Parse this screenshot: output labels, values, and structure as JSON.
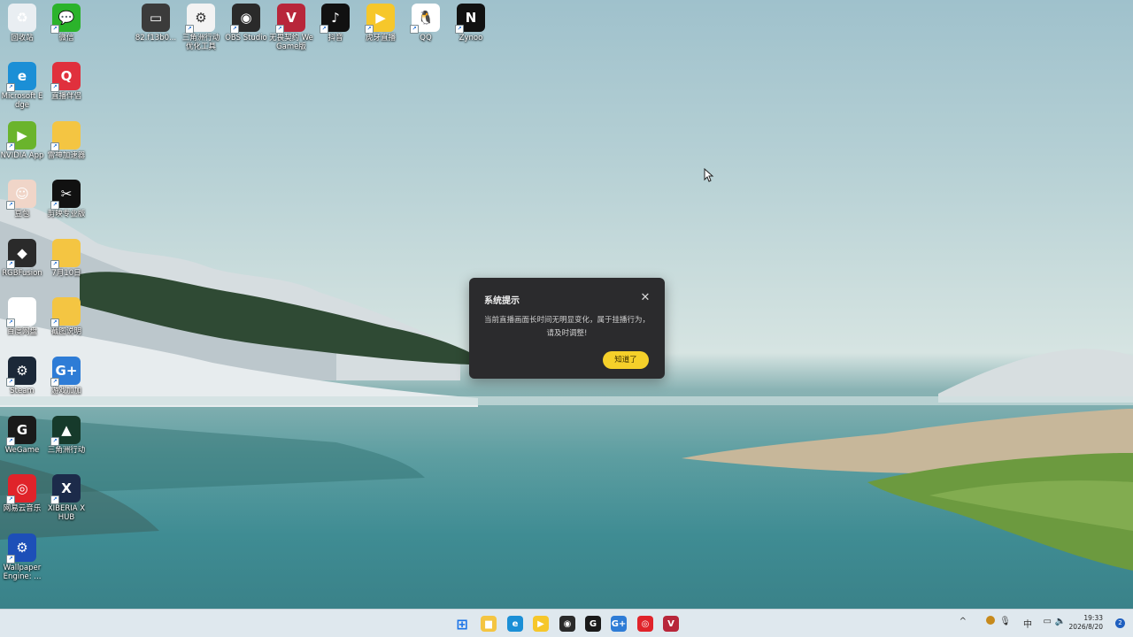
{
  "desktop_icons": [
    {
      "name": "回收站",
      "glyph": "♻",
      "color": "#e9eef2"
    },
    {
      "name": "微信",
      "glyph": "💬",
      "color": "#2bb32b"
    },
    {
      "name": "Microsoft Edge",
      "glyph": "e",
      "color": "#1b8fd6"
    },
    {
      "name": "直播伴侣",
      "glyph": "Q",
      "color": "#e0303d"
    },
    {
      "name": "NVIDIA App",
      "glyph": "▶",
      "color": "#6ab42c"
    },
    {
      "name": "雷神加速器",
      "glyph": "",
      "color": "#f4c542"
    },
    {
      "name": "豆包",
      "glyph": "☺",
      "color": "#f0d5c8"
    },
    {
      "name": "剪映专业版",
      "glyph": "✂",
      "color": "#111111"
    },
    {
      "name": "RGBFusion",
      "glyph": "◆",
      "color": "#2a2a2a"
    },
    {
      "name": "7月10日",
      "glyph": "",
      "color": "#f4c542"
    },
    {
      "name": "百度网盘",
      "glyph": "☁",
      "color": "#ffffff"
    },
    {
      "name": "截图说明",
      "glyph": "",
      "color": "#f4c542"
    },
    {
      "name": "Steam",
      "glyph": "⚙",
      "color": "#1b2838"
    },
    {
      "name": "游戏加加",
      "glyph": "G+",
      "color": "#2e7cd6"
    },
    {
      "name": "WeGame",
      "glyph": "G",
      "color": "#1a1a1a"
    },
    {
      "name": "三角洲行动",
      "glyph": "▲",
      "color": "#163a2b"
    },
    {
      "name": "网易云音乐",
      "glyph": "◎",
      "color": "#e0232a"
    },
    {
      "name": "XIBERIA X HUB",
      "glyph": "X",
      "color": "#1c2b4a"
    },
    {
      "name": "Wallpaper Engine: ...",
      "glyph": "⚙",
      "color": "#1d4fb8"
    }
  ],
  "top_icons": [
    {
      "name": "82.f13b0...",
      "glyph": "▭",
      "color": "#3b3b3b"
    },
    {
      "name": "三角洲行动优化工具",
      "glyph": "⚙",
      "color": "#f3f3f3"
    },
    {
      "name": "OBS Studio",
      "glyph": "◉",
      "color": "#2a2a2a"
    },
    {
      "name": "无畏契约 WeGame版",
      "glyph": "V",
      "color": "#b8263a"
    },
    {
      "name": "抖音",
      "glyph": "♪",
      "color": "#111111"
    },
    {
      "name": "虎牙直播",
      "glyph": "▶",
      "color": "#f6c72b"
    },
    {
      "name": "QQ",
      "glyph": "🐧",
      "color": "#ffffff"
    },
    {
      "name": "Zynoo",
      "glyph": "N",
      "color": "#111111"
    }
  ],
  "dialog": {
    "title": "系统提示",
    "message": "当前直播画面长时间无明显变化，属于挂播行为，请及时调整!",
    "confirm_label": "知道了",
    "close_icon": "close-icon"
  },
  "taskbar": {
    "apps": [
      {
        "name": "start-button",
        "glyph": "⊞",
        "color": "#1a73e8"
      },
      {
        "name": "file-explorer",
        "glyph": "▆",
        "color": "#f4c542"
      },
      {
        "name": "edge",
        "glyph": "e",
        "color": "#1b8fd6"
      },
      {
        "name": "huya",
        "glyph": "▶",
        "color": "#f6c72b"
      },
      {
        "name": "obs",
        "glyph": "◉",
        "color": "#2a2a2a"
      },
      {
        "name": "wegame",
        "glyph": "G",
        "color": "#1a1a1a"
      },
      {
        "name": "game-plus",
        "glyph": "G+",
        "color": "#2e7cd6"
      },
      {
        "name": "netease-music",
        "glyph": "◎",
        "color": "#e0232a"
      },
      {
        "name": "valorant",
        "glyph": "V",
        "color": "#b8263a"
      }
    ],
    "tray": {
      "chevron": "^",
      "ime": "中",
      "time": "19:33",
      "date": "2026/8/20",
      "notifications": "2"
    }
  }
}
